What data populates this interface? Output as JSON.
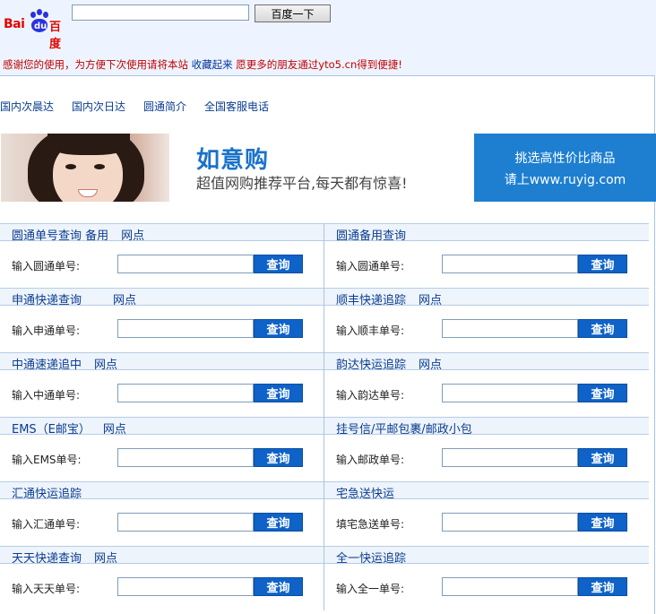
{
  "header": {
    "baidu_logo": {
      "bai": "Bai",
      "du": "du",
      "cn": "百度"
    },
    "search_value": "",
    "search_button": "百度一下"
  },
  "notice": {
    "text_a": "感谢您的使用，为方便下次使用请将本站 ",
    "bookmark": "收藏起来",
    "text_b": " 愿更多的朋友通过yto5.cn得到便捷!"
  },
  "nav": {
    "items": [
      "国内次晨达",
      "国内次日达",
      "圆通简介",
      "全国客服电话"
    ]
  },
  "banner": {
    "brand": "如意购",
    "slogan": "超值网购推荐平台,每天都有惊喜!",
    "promo_line1": "挑选高性价比商品",
    "promo_line2": "请上www.ruyig.com"
  },
  "query_button": "查询",
  "panels": [
    {
      "title": "圆通单号查询",
      "extra": " 备用",
      "np": "网点",
      "label": "输入圆通单号:"
    },
    {
      "title": "圆通备用查询",
      "extra": "",
      "np": "",
      "label": "输入圆通单号:"
    },
    {
      "title": "申通快递查询",
      "extra": "",
      "np": "网点",
      "label": "输入申通单号:"
    },
    {
      "title": "顺丰快递追踪",
      "extra": "",
      "np": "网点",
      "label": "输入顺丰单号:"
    },
    {
      "title": "中通速递追中",
      "extra": "",
      "np": "网点",
      "label": "输入中通单号:"
    },
    {
      "title": "韵达快运追踪",
      "extra": "",
      "np": "网点",
      "label": "输入韵达单号:"
    },
    {
      "title": "EMS（E邮宝）",
      "extra": "",
      "np": "网点",
      "label": "输入EMS单号:"
    },
    {
      "title": "挂号信/平邮包裹/邮政小包",
      "extra": "",
      "np": "",
      "label": "输入邮政单号:"
    },
    {
      "title": "汇通快运追踪",
      "extra": "",
      "np": "",
      "label": "输入汇通单号:"
    },
    {
      "title": "宅急送快运",
      "extra": "",
      "np": "",
      "label": "填宅急送单号:"
    },
    {
      "title": "天天快递查询",
      "extra": "",
      "np": "网点",
      "label": "输入天天单号:"
    },
    {
      "title": "全一快运追踪",
      "extra": "",
      "np": "",
      "label": "输入全一单号:"
    }
  ]
}
